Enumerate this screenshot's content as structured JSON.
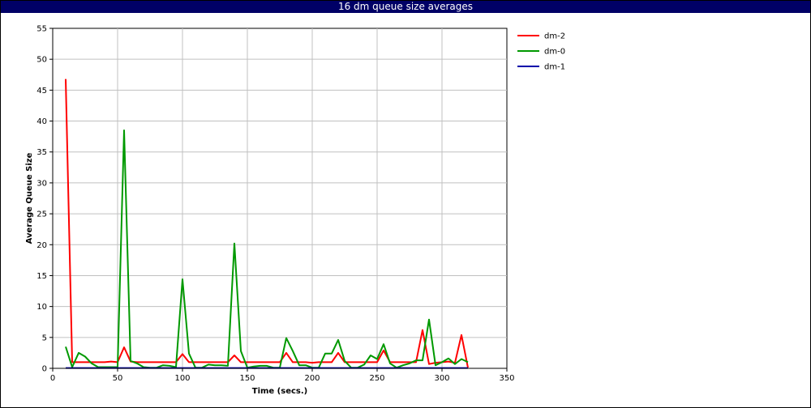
{
  "window": {
    "title": "16 dm queue size averages"
  },
  "chart_data": {
    "type": "line",
    "title": "16 dm queue size averages",
    "xlabel": "Time (secs.)",
    "ylabel": "Average Queue Size",
    "xlim": [
      0,
      350
    ],
    "ylim": [
      0,
      55
    ],
    "xticks": [
      0,
      50,
      100,
      150,
      200,
      250,
      300,
      350
    ],
    "yticks": [
      0,
      5,
      10,
      15,
      20,
      25,
      30,
      35,
      40,
      45,
      50,
      55
    ],
    "grid": true,
    "legend_position": "right",
    "series": [
      {
        "name": "dm-2",
        "color": "#ff0000",
        "x": [
          10,
          15,
          20,
          25,
          30,
          35,
          40,
          45,
          50,
          55,
          60,
          65,
          70,
          75,
          80,
          85,
          90,
          95,
          100,
          105,
          110,
          115,
          120,
          125,
          130,
          135,
          140,
          145,
          150,
          155,
          160,
          165,
          170,
          175,
          180,
          185,
          190,
          195,
          200,
          205,
          210,
          215,
          220,
          225,
          230,
          235,
          240,
          245,
          250,
          255,
          260,
          265,
          270,
          275,
          280,
          285,
          290,
          295,
          300,
          305,
          310,
          315,
          320
        ],
        "y": [
          46.8,
          1.0,
          1.0,
          1.0,
          1.0,
          1.0,
          1.0,
          1.1,
          1.0,
          3.4,
          1.1,
          1.0,
          1.0,
          1.0,
          1.0,
          1.0,
          1.0,
          1.0,
          2.3,
          1.0,
          1.0,
          1.0,
          1.0,
          1.0,
          1.0,
          1.0,
          2.1,
          1.0,
          1.0,
          1.0,
          1.0,
          1.0,
          1.0,
          1.0,
          2.5,
          1.0,
          1.0,
          1.0,
          0.9,
          1.0,
          1.0,
          1.0,
          2.5,
          1.0,
          1.0,
          1.0,
          1.0,
          1.0,
          1.0,
          2.9,
          1.0,
          1.0,
          1.0,
          1.0,
          1.0,
          6.2,
          0.7,
          0.9,
          1.0,
          1.1,
          0.9,
          5.4,
          0.1
        ]
      },
      {
        "name": "dm-0",
        "color": "#009900",
        "x": [
          10,
          15,
          20,
          25,
          30,
          35,
          40,
          45,
          50,
          55,
          60,
          65,
          70,
          75,
          80,
          85,
          90,
          95,
          100,
          105,
          110,
          115,
          120,
          125,
          130,
          135,
          140,
          145,
          150,
          155,
          160,
          165,
          170,
          175,
          180,
          185,
          190,
          195,
          200,
          205,
          210,
          215,
          220,
          225,
          230,
          235,
          240,
          245,
          250,
          255,
          260,
          265,
          270,
          275,
          280,
          285,
          290,
          295,
          300,
          305,
          310,
          315,
          320
        ],
        "y": [
          3.5,
          0.2,
          2.5,
          1.9,
          0.8,
          0.2,
          0.2,
          0.2,
          0.2,
          38.5,
          1.2,
          0.8,
          0.2,
          0.1,
          0.1,
          0.5,
          0.4,
          0.2,
          14.4,
          2.4,
          0.1,
          0.1,
          0.6,
          0.5,
          0.5,
          0.4,
          20.2,
          2.8,
          0.1,
          0.3,
          0.4,
          0.4,
          0.1,
          0.1,
          4.9,
          2.8,
          0.5,
          0.5,
          0.1,
          0.1,
          2.4,
          2.4,
          4.6,
          1.2,
          0.1,
          0.1,
          0.6,
          2.1,
          1.5,
          3.9,
          0.8,
          0.1,
          0.5,
          0.8,
          1.3,
          1.3,
          7.9,
          0.5,
          1.0,
          1.6,
          0.7,
          1.5,
          1.0
        ]
      },
      {
        "name": "dm-1",
        "color": "#0000aa",
        "x": [
          10,
          50,
          100,
          150,
          200,
          250,
          300,
          320
        ],
        "y": [
          0.05,
          0.05,
          0.05,
          0.05,
          0.05,
          0.05,
          0.05,
          0.05
        ]
      }
    ]
  }
}
